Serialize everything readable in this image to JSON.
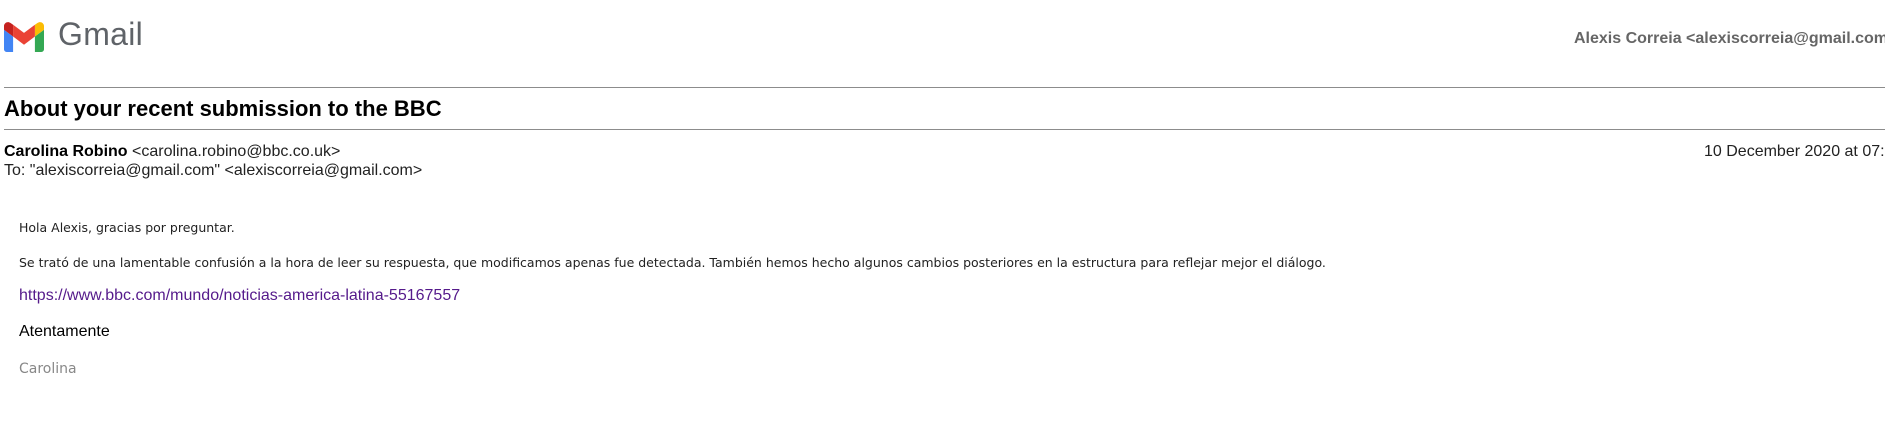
{
  "header": {
    "app_name": "Gmail",
    "logo_icon": "gmail-m-icon",
    "account": "Alexis Correia <alexiscorreia@gmail.com>"
  },
  "message": {
    "subject": "About your recent submission to the BBC",
    "from_name": "Carolina Robino",
    "from_email": "<carolina.robino@bbc.co.uk>",
    "to": "To: \"alexiscorreia@gmail.com\" <alexiscorreia@gmail.com>",
    "date": "10 December 2020 at 07:",
    "body": {
      "greeting": "Hola Alexis, gracias por preguntar.",
      "paragraph": "Se trató de una lamentable confusión a la hora de leer su respuesta, que modificamos apenas fue detectada. También hemos hecho algunos cambios posteriores en la estructura para reflejar mejor el diálogo.",
      "link": "https://www.bbc.com/mundo/noticias-america-latina-55167557",
      "closing": "Atentamente",
      "signature": "Carolina"
    }
  },
  "colors": {
    "link": "#551a8b",
    "logo_red": "#ea4335",
    "logo_blue": "#4285f4",
    "logo_green": "#34a853",
    "logo_yellow": "#fbbc04",
    "logo_darkred": "#c5221f"
  }
}
